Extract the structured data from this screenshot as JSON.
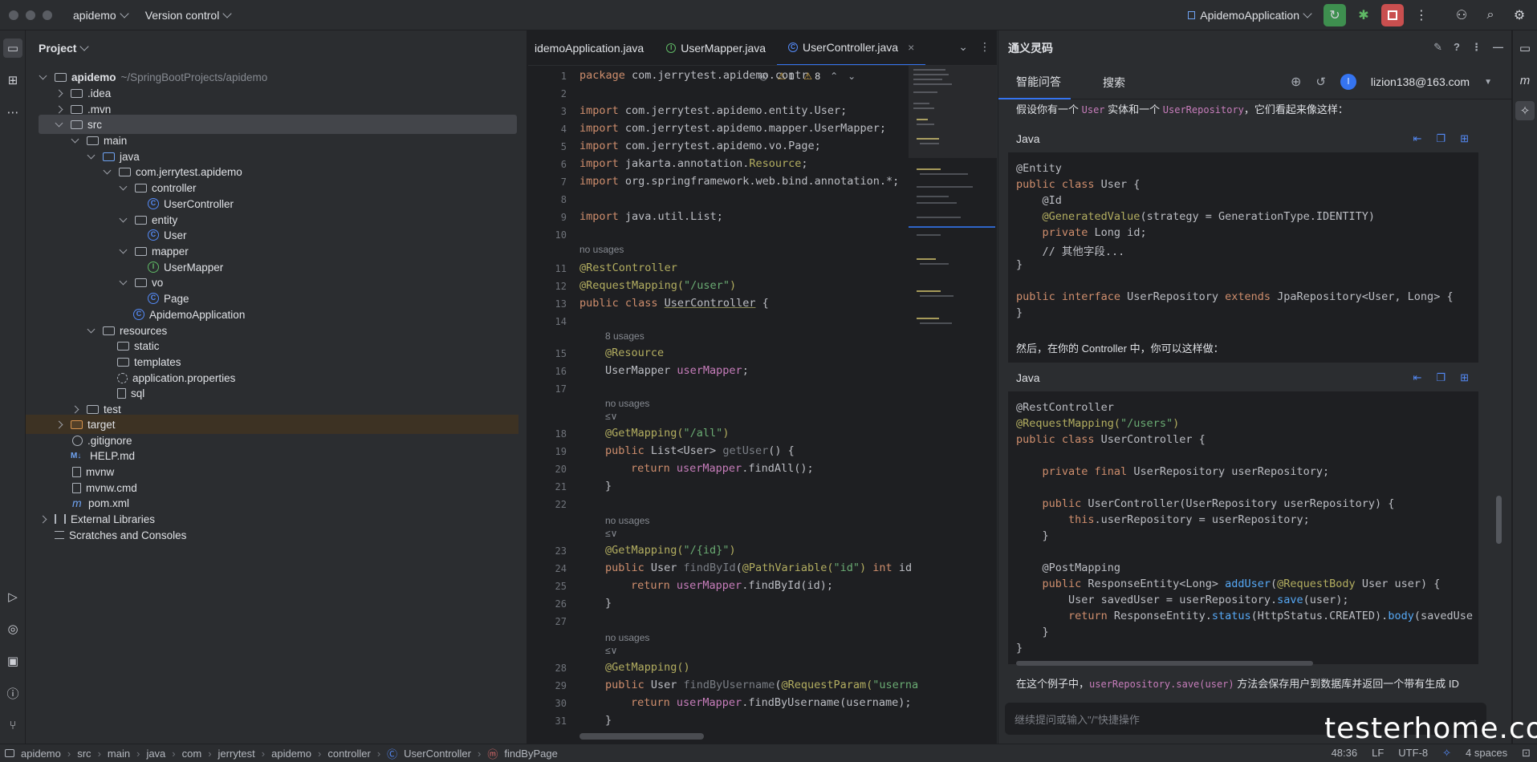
{
  "titlebar": {
    "project": "apidemo",
    "vcs": "Version control",
    "run_config": "ApidemoApplication"
  },
  "project_panel": {
    "title": "Project",
    "root_name": "apidemo",
    "root_path": "~/SpringBootProjects/apidemo",
    "items": [
      {
        "label": ".idea"
      },
      {
        "label": ".mvn"
      },
      {
        "label": "src"
      },
      {
        "label": "main"
      },
      {
        "label": "java"
      },
      {
        "label": "com.jerrytest.apidemo"
      },
      {
        "label": "controller"
      },
      {
        "label": "UserController"
      },
      {
        "label": "entity"
      },
      {
        "label": "User"
      },
      {
        "label": "mapper"
      },
      {
        "label": "UserMapper"
      },
      {
        "label": "vo"
      },
      {
        "label": "Page"
      },
      {
        "label": "ApidemoApplication"
      },
      {
        "label": "resources"
      },
      {
        "label": "static"
      },
      {
        "label": "templates"
      },
      {
        "label": "application.properties"
      },
      {
        "label": "sql"
      },
      {
        "label": "test"
      },
      {
        "label": "target"
      },
      {
        "label": ".gitignore"
      },
      {
        "label": "HELP.md"
      },
      {
        "label": "mvnw"
      },
      {
        "label": "mvnw.cmd"
      },
      {
        "label": "pom.xml"
      },
      {
        "label": "External Libraries"
      },
      {
        "label": "Scratches and Consoles"
      }
    ],
    "md_badge": "M↓"
  },
  "editor": {
    "tabs": [
      {
        "label": "idemoApplication.java"
      },
      {
        "label": "UserMapper.java"
      },
      {
        "label": "UserController.java"
      }
    ],
    "warnings": {
      "weak": "1",
      "warn": "8"
    },
    "line_numbers": [
      "1",
      "2",
      "3",
      "4",
      "5",
      "6",
      "7",
      "8",
      "9",
      "10",
      "11",
      "12",
      "13",
      "14",
      "15",
      "16",
      "17",
      "18",
      "19",
      "20",
      "21",
      "22",
      "23",
      "24",
      "25",
      "26",
      "27",
      "28",
      "29",
      "30",
      "31"
    ],
    "hints": {
      "no_usages": "no usages",
      "eight_usages": "8 usages",
      "ai_glyph": "≤∨"
    },
    "code": {
      "l1_a": "package ",
      "l1_b": "com.jerrytest.apidemo.contr",
      "l3_a": "import ",
      "l3_b": "com.jerrytest.apidemo.entity.User;",
      "l4_a": "import ",
      "l4_b": "com.jerrytest.apidemo.mapper.UserMapper;",
      "l5_a": "import ",
      "l5_b": "com.jerrytest.apidemo.vo.Page;",
      "l6_a": "import ",
      "l6_b": "jakarta.annotation.",
      "l6_c": "Resource",
      "l6_d": ";",
      "l7_a": "import ",
      "l7_b": "org.springframework.web.bind.annotation.*;",
      "l9_a": "import ",
      "l9_b": "java.util.List;",
      "l11": "@RestController",
      "l12_a": "@RequestMapping(",
      "l12_b": "\"/user\"",
      "l12_c": ")",
      "l13_a": "public class ",
      "l13_b": "UserController",
      "l13_c": " {",
      "l15": "@Resource",
      "l16_a": "UserMapper ",
      "l16_b": "userMapper",
      "l16_c": ";",
      "l18_a": "@GetMapping(",
      "l18_b": "\"/all\"",
      "l18_c": ")",
      "l19_a": "public ",
      "l19_b": "List<User> ",
      "l19_c": "getUser",
      "l19_d": "() {",
      "l20_a": "return ",
      "l20_b": "userMapper",
      "l20_c": ".findAll();",
      "l21": "}",
      "l23_a": "@GetMapping(",
      "l23_b": "\"/{id}\"",
      "l23_c": ")",
      "l24_a": "public ",
      "l24_b": "User ",
      "l24_c": "findById",
      "l24_d": "(",
      "l24_e": "@PathVariable(",
      "l24_f": "\"id\"",
      "l24_g": ") ",
      "l24_h": "int ",
      "l24_i": "id",
      "l25_a": "return ",
      "l25_b": "userMapper",
      "l25_c": ".findById(id);",
      "l26": "}",
      "l28": "@GetMapping()",
      "l29_a": "public ",
      "l29_b": "User ",
      "l29_c": "findByUsername",
      "l29_d": "(",
      "l29_e": "@RequestParam(",
      "l29_f": "\"userna",
      "l30_a": "return ",
      "l30_b": "userMapper",
      "l30_c": ".findByUsername(username);",
      "l31": "}"
    }
  },
  "ai_panel": {
    "title": "通义灵码",
    "tabs": [
      "智能问答",
      "搜索"
    ],
    "account": "lizion138@163.com",
    "avatar_letter": "l",
    "intro": {
      "a": "假设你有一个 ",
      "b": "User",
      "c": " 实体和一个 ",
      "d": "UserRepository",
      "e": "，它们看起来像这样："
    },
    "block1_lang": "Java",
    "block1": {
      "l1": "@Entity",
      "l2_a": "public class ",
      "l2_b": "User {",
      "l3": "    @Id",
      "l4_a": "    @GeneratedValue",
      "l4_b": "(strategy = GenerationType.IDENTITY)",
      "l5_a": "    private ",
      "l5_b": "Long id;",
      "l6": "    // 其他字段...",
      "l7": "}",
      "l9_a": "public interface ",
      "l9_b": "UserRepository ",
      "l9_c": "extends ",
      "l9_d": "JpaRepository<User, Long> {",
      "l10": "}"
    },
    "middle": "然后，在你的 Controller 中，你可以这样做：",
    "block2_lang": "Java",
    "block2": {
      "l1": "@RestController",
      "l2_a": "@RequestMapping(",
      "l2_b": "\"/users\"",
      "l2_c": ")",
      "l3_a": "public class ",
      "l3_b": "UserController {",
      "l5_a": "    private final ",
      "l5_b": "UserRepository userRepository;",
      "l7_a": "    public ",
      "l7_b": "UserController(UserRepository userRepository) {",
      "l8_a": "        this",
      "l8_b": ".userRepository = userRepository;",
      "l9": "    }",
      "l11": "    @PostMapping",
      "l12_a": "    public ",
      "l12_b": "ResponseEntity<Long> ",
      "l12_c": "addUser",
      "l12_d": "(",
      "l12_e": "@RequestBody",
      "l12_f": " User user) {",
      "l13_a": "        User savedUser = userRepository.",
      "l13_b": "save",
      "l13_c": "(user);",
      "l14_a": "        return ",
      "l14_b": "ResponseEntity.",
      "l14_c": "status",
      "l14_d": "(HttpStatus.CREATED).",
      "l14_e": "body",
      "l14_f": "(savedUse",
      "l15": "    }",
      "l16": "}"
    },
    "outro": {
      "a": "在这个例子中，",
      "b": "userRepository.save(user)",
      "c": " 方法会保存用户到数据库并返回一个带有生成 ID"
    },
    "input_placeholder": "继续提问或输入\"/\"快捷操作"
  },
  "statusbar": {
    "breadcrumb": [
      "apidemo",
      "src",
      "main",
      "java",
      "com",
      "jerrytest",
      "apidemo",
      "controller",
      "UserController",
      "findByPage"
    ],
    "position": "48:36",
    "line_sep": "LF",
    "encoding": "UTF-8",
    "indent": "4 spaces"
  },
  "watermark": "testerhome.com"
}
